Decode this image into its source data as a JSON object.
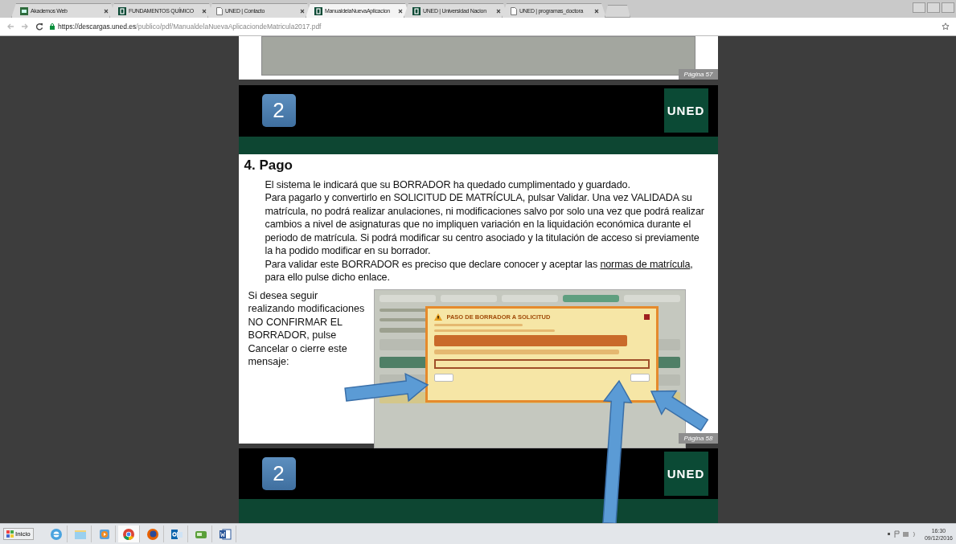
{
  "browser": {
    "tabs": [
      {
        "title": "Akademos Web",
        "kind": "akademos",
        "selected": false
      },
      {
        "title": "FUNDAMENTOS QUÍMICO",
        "kind": "uned",
        "selected": false
      },
      {
        "title": "UNED | Contacto",
        "kind": "page",
        "selected": false
      },
      {
        "title": "ManualdelaNuevaAplicacion",
        "kind": "uned",
        "selected": true
      },
      {
        "title": "UNED | Universidad Nacion",
        "kind": "uned",
        "selected": false
      },
      {
        "title": "UNED | programas_doctora",
        "kind": "page",
        "selected": false
      }
    ],
    "address": {
      "host": "https://descargas.uned.es",
      "path": "/publico/pdf/ManualdelaNuevaAplicaciondeMatricula2017.pdf"
    }
  },
  "previous_page": {
    "page_label": "Página 57"
  },
  "slide": {
    "number": "2",
    "logo": "UNED"
  },
  "section": {
    "heading": "4. Pago",
    "paragraphs": [
      {
        "before": "El sistema le indicará que su BORRADOR ha quedado cumplimentado y guardado."
      },
      {
        "before": "Para pagarlo y convertirlo en SOLICITUD DE MATRÍCULA, pulsar Validar. Una vez VALIDADA su matrícula, no podrá realizar anulaciones, ni modificaciones salvo por solo una vez que podrá realizar cambios a nivel de asignaturas que no impliquen variación en la liquidación económica durante el periodo de matrícula. Si podrá modificar su centro asociado y la titulación de acceso si previamente la ha podido modificar en su borrador."
      },
      {
        "before": "Para validar este BORRADOR es preciso que declare conocer y aceptar las ",
        "link": "normas de matrícula",
        "after": ", para ello pulse dicho enlace."
      }
    ],
    "side_note": "Si desea seguir realizando modificaciones NO CONFIRMAR EL BORRADOR, pulse Cancelar o cierre este mensaje:",
    "screenshot": {
      "dialog_title": "PASO DE BORRADOR A SOLICITUD"
    },
    "page_label": "Página 58"
  },
  "next_slide": {
    "number": "2",
    "logo": "UNED"
  },
  "taskbar": {
    "start": "Inicio",
    "apps": [
      {
        "kind": "ie"
      },
      {
        "kind": "folder"
      },
      {
        "kind": "media"
      },
      {
        "kind": "chrome"
      },
      {
        "kind": "firefox"
      },
      {
        "kind": "outlook"
      },
      {
        "kind": "putty"
      },
      {
        "kind": "word"
      }
    ],
    "time": "16:30",
    "date": "09/12/2016"
  }
}
